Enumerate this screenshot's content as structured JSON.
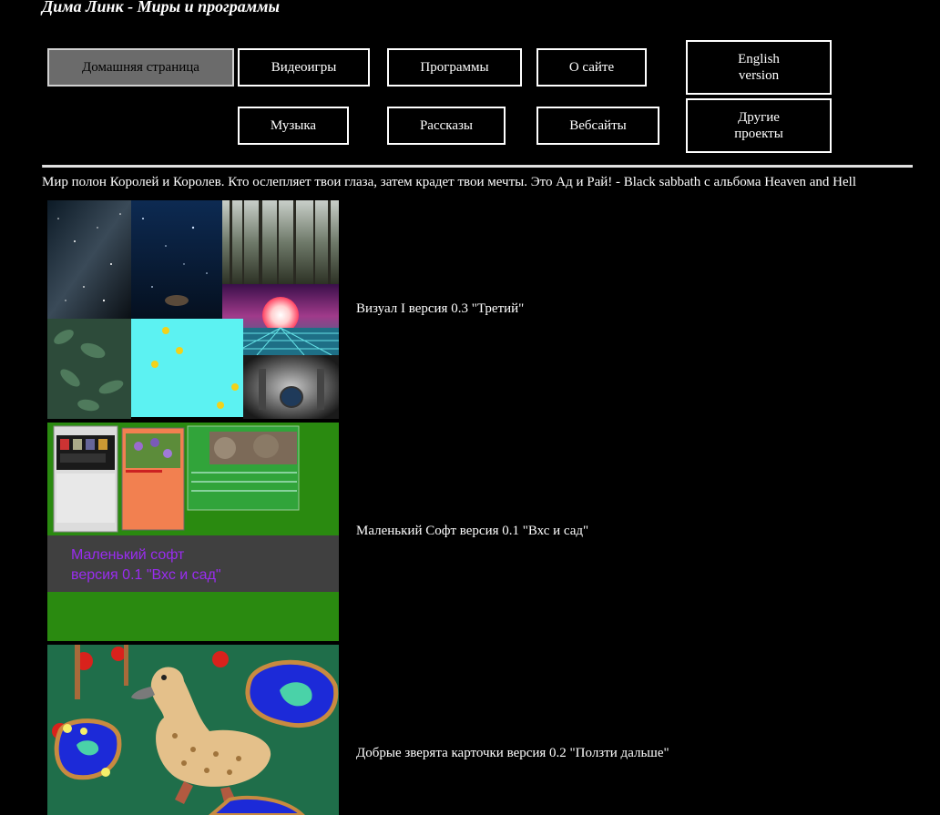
{
  "site": {
    "title": "Дима Линк - Миры и программы"
  },
  "nav": {
    "home": "Домашняя страница",
    "videogames": "Видеоигры",
    "programs": "Программы",
    "about": "О сайте",
    "english": "English\nversion",
    "music": "Музыка",
    "stories": "Рассказы",
    "websites": "Вебсайты",
    "other": "Другие\nпроекты"
  },
  "quote": "Мир полон Королей и Королев. Кто ослепляет твои глаза, затем крадет твои мечты. Это Ад и Рай! - Black sabbath с альбома Heaven and Hell",
  "projects": [
    {
      "caption": "Визуал I версия 0.3 \"Третий\""
    },
    {
      "caption": "Маленький Софт версия 0.1 \"Вхс и сад\"",
      "thumb_line1": "Маленький софт",
      "thumb_line2": "версия 0.1 \"Вхс и сад\""
    },
    {
      "caption": "Добрые зверята карточки версия 0.2 \"Ползти дальше\""
    }
  ]
}
